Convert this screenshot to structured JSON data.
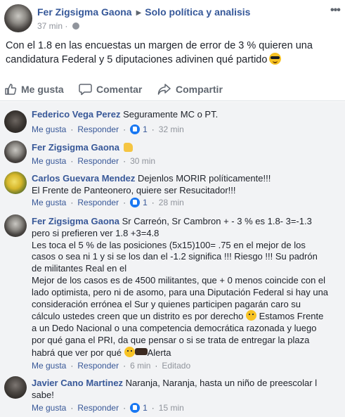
{
  "post": {
    "author": "Fer Zigsigma Gaona",
    "group": "Solo política y analisis",
    "time": "37 min",
    "more": "•••",
    "text": "Con el 1.8 en las encuestas un margen de error de 3 % quieren una candidatura Federal y 5 diputaciones adivinen qué partido"
  },
  "actions": {
    "like": "Me gusta",
    "comment": "Comentar",
    "share": "Compartir"
  },
  "comment_actions": {
    "like": "Me gusta",
    "reply": "Responder",
    "dot": "·"
  },
  "comments": [
    {
      "author": "Federico Vega Perez",
      "text": "Seguramente MC o PT.",
      "likes": "1",
      "time": "32 min"
    },
    {
      "author": "Fer Zigsigma Gaona",
      "text": "",
      "time": "30 min"
    },
    {
      "author": "Carlos Guevara Mendez",
      "text": "Dejenlos MORIR políticamente!!!",
      "text2": "El Frente de Panteonero, quiere ser Resucitador!!!",
      "likes": "1",
      "time": "28 min"
    },
    {
      "author": "Fer Zigsigma Gaona",
      "lines": [
        "Sr Carreón, Sr Cambron + - 3 % es 1.8- 3=-1.3",
        "pero si prefieren ver 1.8 +3=4.8",
        "Les toca el 5 % de las posiciones (5x15)100= .75 en el mejor de los",
        "casos o sea ni 1 y si se los dan el -1.2 significa !!! Riesgo !!! Su padrón",
        "de militantes Real en el",
        "Mejor de los casos es de 4500 militantes, que + 0 menos coincide con el",
        "lado optimista, pero ni de asomo, para una Diputación Federal si hay una",
        "consideración errónea el Sur y quienes participen pagarán caro su",
        "cálculo ustedes creen que un distrito es por derecho",
        "Estamos Frente",
        "a un Dedo Nacional o una competencia democrática razonada y luego",
        "por qué gana el PRI, da que pensar o si se trata de entregar la plaza",
        "habrá que ver por qué",
        "Alerta"
      ],
      "time": "6 min",
      "edited": "Editado"
    },
    {
      "author": "Javier Cano Martinez",
      "text": "Naranja, Naranja, hasta un niño de preescolar l",
      "text2": "sabe!",
      "likes": "1",
      "time": "15 min"
    }
  ],
  "colors": {
    "link": "#385898",
    "muted": "#90949c",
    "comment_bg": "#f2f3f5",
    "like_blue": "#1877f2"
  },
  "icons": [
    "globe-icon",
    "more-icon",
    "like-icon",
    "comment-icon",
    "share-icon",
    "like-badge-icon",
    "sunglasses-emoji",
    "thumbs-up-emoji",
    "thinking-emoji",
    "pointing-emoji"
  ]
}
